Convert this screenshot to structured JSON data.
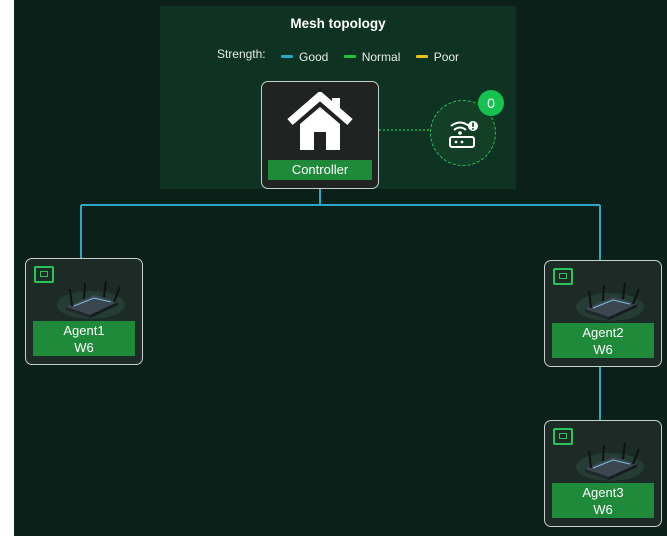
{
  "title": "Mesh topology",
  "legend": {
    "label": "Strength:",
    "items": [
      {
        "name": "Good",
        "color": "#2aa7c4"
      },
      {
        "name": "Normal",
        "color": "#1fc23c"
      },
      {
        "name": "Poor",
        "color": "#e6c21a"
      }
    ]
  },
  "controller": {
    "label": "Controller",
    "icon": "home-icon"
  },
  "unconnected": {
    "count": "0",
    "icon": "router-warning-icon"
  },
  "agents": [
    {
      "name": "Agent1",
      "model": "W6"
    },
    {
      "name": "Agent2",
      "model": "W6"
    },
    {
      "name": "Agent3",
      "model": "W6"
    }
  ],
  "colors": {
    "background": "#0b2018",
    "panel": "#0f3322",
    "link": "#2aa7c4",
    "accent": "#1f8a3a"
  }
}
